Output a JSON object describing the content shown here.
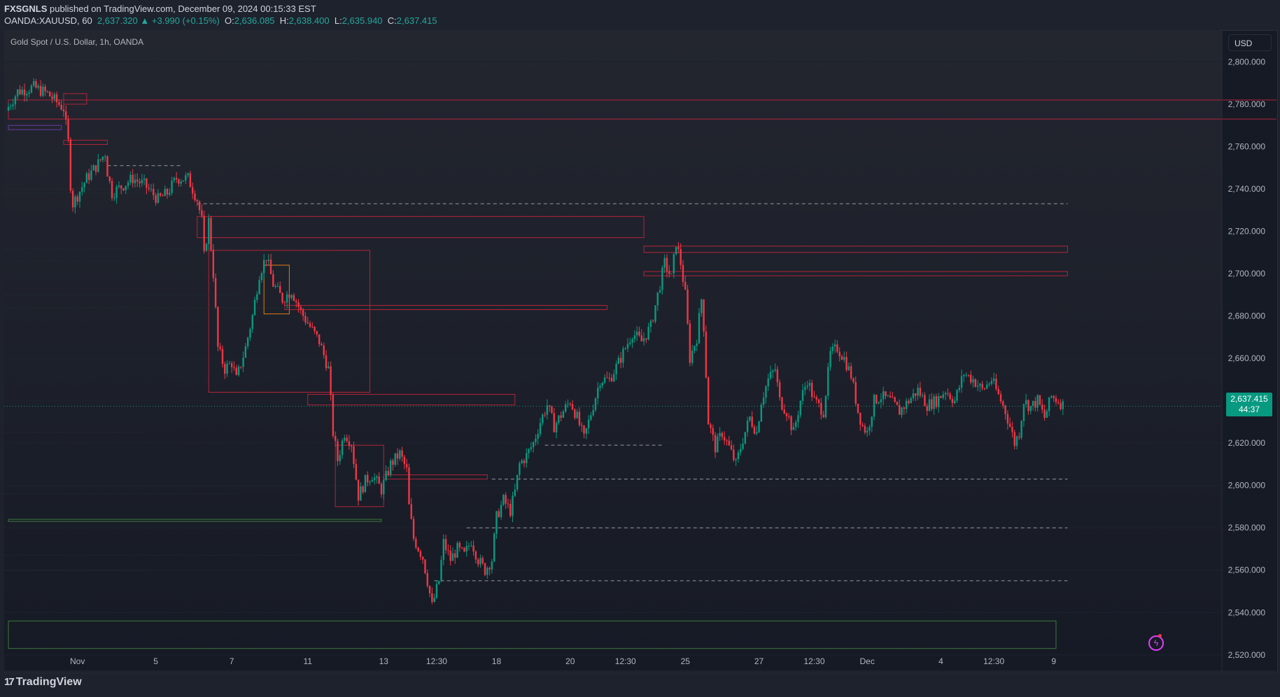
{
  "header": {
    "publisher": "FXSGNLS",
    "published_text": " published on TradingView.com, December 09, 2024 00:15:33 EST",
    "symbol": "OANDA:XAUUSD, 60",
    "last": "2,637.320",
    "change": "▲ +3.990 (+0.15%)",
    "o_label": "O:",
    "o_value": "2,636.085",
    "h_label": "H:",
    "h_value": "2,638.400",
    "l_label": "L:",
    "l_value": "2,635.940",
    "c_label": "C:",
    "c_value": "2,637.415"
  },
  "chart_title": "Gold Spot / U.S. Dollar, 1h, OANDA",
  "currency": "USD",
  "price_tag": {
    "price": "2,637.415",
    "countdown": "44:37"
  },
  "brand": "TradingView",
  "colors": {
    "up": "#089981",
    "down": "#f23645",
    "background": "#161a25",
    "zone_red": "#b2243a",
    "zone_green": "#3a7a3a",
    "zone_orange": "#e07b18",
    "dashed": "#9598a1"
  },
  "icons": {
    "logo": "tradingview-logo-icon",
    "alert": "lightning-icon"
  },
  "chart_data": {
    "type": "candlestick",
    "title": "Gold Spot / U.S. Dollar, 1h, OANDA",
    "ylim": [
      2512,
      2815
    ],
    "y_ticks": [
      "2,800.000",
      "2,780.000",
      "2,760.000",
      "2,740.000",
      "2,720.000",
      "2,700.000",
      "2,680.000",
      "2,660.000",
      "2,640.000",
      "2,620.000",
      "2,600.000",
      "2,580.000",
      "2,560.000",
      "2,540.000",
      "2,520.000"
    ],
    "y_tick_values": [
      2800,
      2780,
      2760,
      2740,
      2720,
      2700,
      2680,
      2660,
      2640,
      2620,
      2600,
      2580,
      2560,
      2540,
      2520
    ],
    "x_ticks": [
      "Nov",
      "5",
      "7",
      "11",
      "13",
      "12:30",
      "18",
      "20",
      "12:30",
      "25",
      "27",
      "12:30",
      "Dec",
      "4",
      "12:30",
      "9"
    ],
    "x_tick_bars": [
      30,
      64,
      97,
      130,
      163,
      186,
      212,
      244,
      268,
      294,
      326,
      350,
      373,
      405,
      428,
      454
    ],
    "path": [
      [
        0,
        2777
      ],
      [
        5,
        2786
      ],
      [
        12,
        2788
      ],
      [
        18,
        2785
      ],
      [
        25,
        2778
      ],
      [
        27,
        2762
      ],
      [
        28,
        2742
      ],
      [
        29,
        2733
      ],
      [
        35,
        2745
      ],
      [
        40,
        2752
      ],
      [
        43,
        2757
      ],
      [
        44,
        2748
      ],
      [
        46,
        2738
      ],
      [
        55,
        2745
      ],
      [
        60,
        2742
      ],
      [
        66,
        2735
      ],
      [
        70,
        2738
      ],
      [
        74,
        2745
      ],
      [
        79,
        2745
      ],
      [
        83,
        2735
      ],
      [
        85,
        2725
      ],
      [
        86,
        2708
      ],
      [
        88,
        2725
      ],
      [
        90,
        2700
      ],
      [
        92,
        2665
      ],
      [
        95,
        2655
      ],
      [
        98,
        2658
      ],
      [
        100,
        2650
      ],
      [
        104,
        2665
      ],
      [
        107,
        2680
      ],
      [
        110,
        2700
      ],
      [
        113,
        2708
      ],
      [
        116,
        2695
      ],
      [
        120,
        2688
      ],
      [
        124,
        2692
      ],
      [
        128,
        2682
      ],
      [
        132,
        2675
      ],
      [
        136,
        2668
      ],
      [
        140,
        2655
      ],
      [
        142,
        2625
      ],
      [
        144,
        2612
      ],
      [
        147,
        2625
      ],
      [
        150,
        2620
      ],
      [
        153,
        2595
      ],
      [
        156,
        2602
      ],
      [
        159,
        2605
      ],
      [
        163,
        2598
      ],
      [
        167,
        2610
      ],
      [
        171,
        2615
      ],
      [
        174,
        2607
      ],
      [
        175,
        2590
      ],
      [
        177,
        2575
      ],
      [
        181,
        2566
      ],
      [
        183,
        2555
      ],
      [
        185,
        2543
      ],
      [
        188,
        2555
      ],
      [
        190,
        2573
      ],
      [
        193,
        2565
      ],
      [
        196,
        2570
      ],
      [
        199,
        2567
      ],
      [
        202,
        2574
      ],
      [
        205,
        2565
      ],
      [
        208,
        2560
      ],
      [
        211,
        2565
      ],
      [
        213,
        2585
      ],
      [
        216,
        2593
      ],
      [
        219,
        2588
      ],
      [
        221,
        2597
      ],
      [
        223,
        2610
      ],
      [
        226,
        2614
      ],
      [
        229,
        2620
      ],
      [
        232,
        2630
      ],
      [
        235,
        2638
      ],
      [
        238,
        2628
      ],
      [
        242,
        2635
      ],
      [
        245,
        2640
      ],
      [
        248,
        2632
      ],
      [
        251,
        2622
      ],
      [
        255,
        2638
      ],
      [
        258,
        2650
      ],
      [
        262,
        2650
      ],
      [
        266,
        2658
      ],
      [
        269,
        2665
      ],
      [
        272,
        2672
      ],
      [
        276,
        2668
      ],
      [
        280,
        2675
      ],
      [
        283,
        2690
      ],
      [
        286,
        2705
      ],
      [
        289,
        2698
      ],
      [
        291,
        2715
      ],
      [
        293,
        2705
      ],
      [
        295,
        2690
      ],
      [
        297,
        2660
      ],
      [
        300,
        2670
      ],
      [
        302,
        2688
      ],
      [
        303,
        2675
      ],
      [
        305,
        2630
      ],
      [
        308,
        2618
      ],
      [
        311,
        2625
      ],
      [
        314,
        2618
      ],
      [
        317,
        2610
      ],
      [
        320,
        2622
      ],
      [
        323,
        2632
      ],
      [
        326,
        2625
      ],
      [
        328,
        2640
      ],
      [
        331,
        2650
      ],
      [
        334,
        2655
      ],
      [
        336,
        2640
      ],
      [
        339,
        2635
      ],
      [
        342,
        2625
      ],
      [
        345,
        2640
      ],
      [
        348,
        2650
      ],
      [
        351,
        2640
      ],
      [
        355,
        2635
      ],
      [
        358,
        2662
      ],
      [
        361,
        2665
      ],
      [
        364,
        2660
      ],
      [
        367,
        2652
      ],
      [
        370,
        2635
      ],
      [
        372,
        2628
      ],
      [
        374,
        2625
      ],
      [
        377,
        2640
      ],
      [
        380,
        2642
      ],
      [
        384,
        2640
      ],
      [
        388,
        2635
      ],
      [
        392,
        2640
      ],
      [
        396,
        2645
      ],
      [
        400,
        2638
      ],
      [
        404,
        2640
      ],
      [
        408,
        2645
      ],
      [
        412,
        2640
      ],
      [
        416,
        2653
      ],
      [
        420,
        2650
      ],
      [
        424,
        2645
      ],
      [
        428,
        2650
      ],
      [
        432,
        2640
      ],
      [
        434,
        2635
      ],
      [
        436,
        2628
      ],
      [
        438,
        2620
      ],
      [
        440,
        2625
      ],
      [
        442,
        2640
      ],
      [
        445,
        2637
      ],
      [
        448,
        2640
      ],
      [
        451,
        2632
      ],
      [
        454,
        2642
      ],
      [
        457,
        2640
      ],
      [
        459,
        2638
      ]
    ],
    "last_price": 2637.415
  }
}
